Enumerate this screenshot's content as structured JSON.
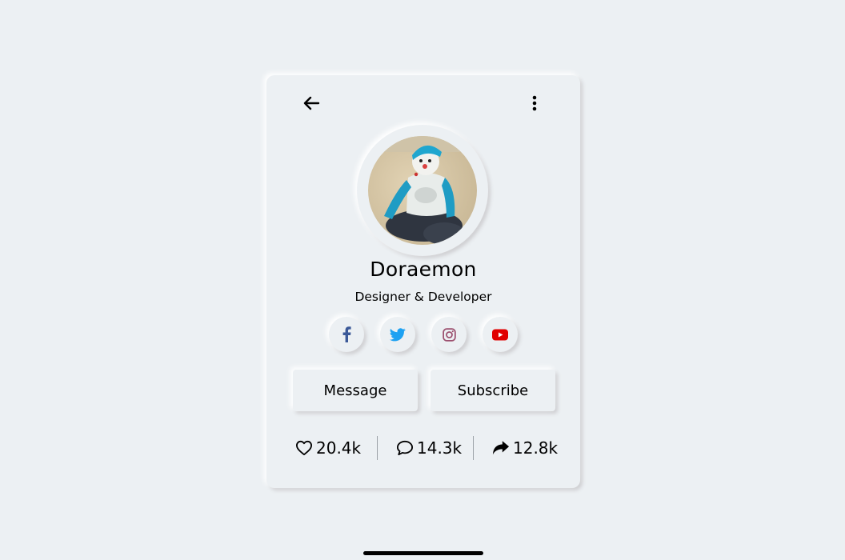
{
  "profile": {
    "name": "Doraemon",
    "title": "Designer & Developer"
  },
  "header": {
    "back_icon": "arrow-left-icon",
    "menu_icon": "more-vertical-icon"
  },
  "socials": [
    {
      "name": "facebook",
      "icon": "facebook-icon",
      "color": "#3b5998"
    },
    {
      "name": "twitter",
      "icon": "twitter-icon",
      "color": "#1da1f2"
    },
    {
      "name": "instagram",
      "icon": "instagram-icon",
      "color": "#9b4f6e"
    },
    {
      "name": "youtube",
      "icon": "youtube-icon",
      "color": "#e00000"
    }
  ],
  "actions": {
    "message_label": "Message",
    "subscribe_label": "Subscribe"
  },
  "stats": {
    "likes": "20.4k",
    "comments": "14.3k",
    "shares": "12.8k"
  },
  "colors": {
    "background": "#ecf0f3",
    "shadow_light": "#ffffff",
    "shadow_dark": "#ceced1"
  }
}
